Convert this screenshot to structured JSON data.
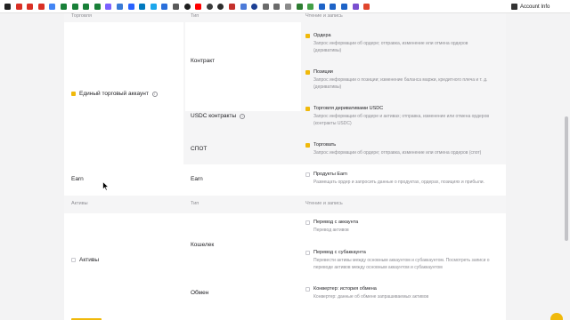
{
  "bookmarks": [
    {
      "name": "tab-icon",
      "color": "#222222",
      "shape": "square"
    },
    {
      "name": "gmail-icon",
      "color": "#d93025",
      "shape": "square"
    },
    {
      "name": "gmail-icon",
      "color": "#d93025",
      "shape": "square"
    },
    {
      "name": "gmail-icon",
      "color": "#d93025",
      "shape": "square"
    },
    {
      "name": "google-docs-icon",
      "color": "#4285f4",
      "shape": "square"
    },
    {
      "name": "google-sheets-icon",
      "color": "#188038",
      "shape": "square"
    },
    {
      "name": "google-sheets-icon",
      "color": "#188038",
      "shape": "square"
    },
    {
      "name": "google-sheets-icon",
      "color": "#188038",
      "shape": "square"
    },
    {
      "name": "google-sheets-icon",
      "color": "#188038",
      "shape": "square"
    },
    {
      "name": "grid-icon",
      "color": "#7b61ff",
      "shape": "square"
    },
    {
      "name": "grid-icon",
      "color": "#3a7bd5",
      "shape": "square"
    },
    {
      "name": "tradingview-icon",
      "color": "#2962ff",
      "shape": "square"
    },
    {
      "name": "trello-icon",
      "color": "#0079bf",
      "shape": "square"
    },
    {
      "name": "app-icon",
      "color": "#1ca7ec",
      "shape": "square"
    },
    {
      "name": "arrow-icon",
      "color": "#2a6fdb",
      "shape": "square"
    },
    {
      "name": "box-icon",
      "color": "#5a5a5a",
      "shape": "square"
    },
    {
      "name": "globe-icon",
      "color": "#1e1e1e",
      "shape": "round"
    },
    {
      "name": "youtube-icon",
      "color": "#ff0000",
      "shape": "square"
    },
    {
      "name": "globe-icon",
      "color": "#3c3c3c",
      "shape": "round"
    },
    {
      "name": "globe-icon",
      "color": "#2c2c2c",
      "shape": "round"
    },
    {
      "name": "video-icon",
      "color": "#c4302b",
      "shape": "square"
    },
    {
      "name": "shield-icon",
      "color": "#4c7bd9",
      "shape": "square"
    },
    {
      "name": "circle-icon",
      "color": "#1c3f94",
      "shape": "round"
    },
    {
      "name": "grid-icon",
      "color": "#6b6b6b",
      "shape": "square"
    },
    {
      "name": "grid-icon",
      "color": "#6b6b6b",
      "shape": "square"
    },
    {
      "name": "grid-icon",
      "color": "#8a8a8a",
      "shape": "square"
    },
    {
      "name": "leaf-icon",
      "color": "#2e7d32",
      "shape": "square"
    },
    {
      "name": "chart-icon",
      "color": "#43a047",
      "shape": "square"
    },
    {
      "name": "check-icon",
      "color": "#1e63c7",
      "shape": "square"
    },
    {
      "name": "check-icon",
      "color": "#1e63c7",
      "shape": "square"
    },
    {
      "name": "check-icon",
      "color": "#1e63c7",
      "shape": "square"
    },
    {
      "name": "grid-icon",
      "color": "#7a4fd0",
      "shape": "square"
    },
    {
      "name": "flag-icon",
      "color": "#e0452c",
      "shape": "square"
    }
  ],
  "account_button": {
    "label": "Account Info"
  },
  "section_trading": {
    "headers": {
      "product": "Торговля",
      "type": "Тип",
      "access": "Чтение и запись"
    },
    "product_label": "Единый торговый аккаунт",
    "types": [
      {
        "label": "Контракт"
      },
      {
        "label": "USDC контракты"
      },
      {
        "label": "СПОТ"
      }
    ],
    "permissions": [
      {
        "title": "Ордера",
        "desc": "Запрос информации об ордере; отправка, изменение или отмена ордеров (деривативы)"
      },
      {
        "title": "Позиции",
        "desc": "Запрос информации о позиции; изменение баланса маржи, кредитного плеча и т. д. (деривативы)"
      },
      {
        "title": "Торговля деривативами USDC",
        "desc": "Запрос информации об ордере и активах; отправка, изменение или отмена ордеров (контракты USDC)"
      },
      {
        "title": "Торговать",
        "desc": "Запрос информации об ордере; отправка, изменение или отмена ордеров (спот)"
      }
    ]
  },
  "section_earn": {
    "product_label": "Earn",
    "type_label": "Earn",
    "permission": {
      "title": "Продукты Earn",
      "desc": "Размещать ордер и запросить данные о продуктах, ордерах, позициях и прибыли."
    }
  },
  "section_assets": {
    "headers": {
      "product": "Активы",
      "type": "Тип",
      "access": "Чтение и запись"
    },
    "product_label": "Активы",
    "types": [
      {
        "label": "Кошелек"
      },
      {
        "label": "Обмен"
      }
    ],
    "permissions": [
      {
        "title": "Перевод с аккаунта",
        "desc": "Перевод активов"
      },
      {
        "title": "Перевод с субаккаунта",
        "desc": "Перевести активы между основным аккаунтом и субаккаунтом. Посмотреть записи о переводе активов между основным аккаунтом и субаккаунтом"
      },
      {
        "title": "Конвертер: история обмена",
        "desc": "Конвертер: данные об обмене запрашиваемых активов"
      }
    ]
  },
  "colors": {
    "accent": "#f0b90b",
    "text": "#1e1e22",
    "muted": "#8d8d93",
    "background": "#f3f3f4",
    "band": "#f5f5f6"
  }
}
